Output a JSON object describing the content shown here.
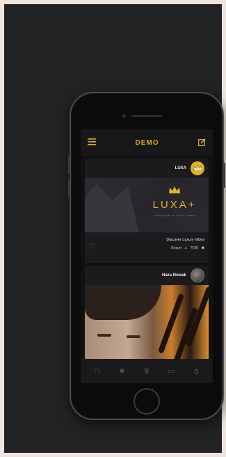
{
  "app": {
    "brand": "DEMO"
  },
  "colors": {
    "accent": "#d7a820",
    "heart": "#e0323f",
    "background": "#222325"
  },
  "posts": [
    {
      "name": "LUXA",
      "banner_title": "LUXA+",
      "banner_subtitle": "DISCOVER LUXURY VIBES",
      "caption": "Discover Luxury Vibes",
      "report": "Report",
      "count": "7F0K"
    },
    {
      "name": "Haza Nowak"
    }
  ],
  "icons": {
    "menu": "menu-icon",
    "edit": "edit-icon",
    "crown": "crown-icon",
    "heart": "heart-icon",
    "warning": "warning-icon",
    "person": "person-icon"
  },
  "tabs": [
    {
      "name": "profile",
      "glyph": "⚇"
    },
    {
      "name": "settings",
      "glyph": "✹"
    },
    {
      "name": "crown",
      "glyph": "♛"
    },
    {
      "name": "chat",
      "glyph": "▭"
    },
    {
      "name": "home",
      "glyph": "⌂"
    }
  ]
}
